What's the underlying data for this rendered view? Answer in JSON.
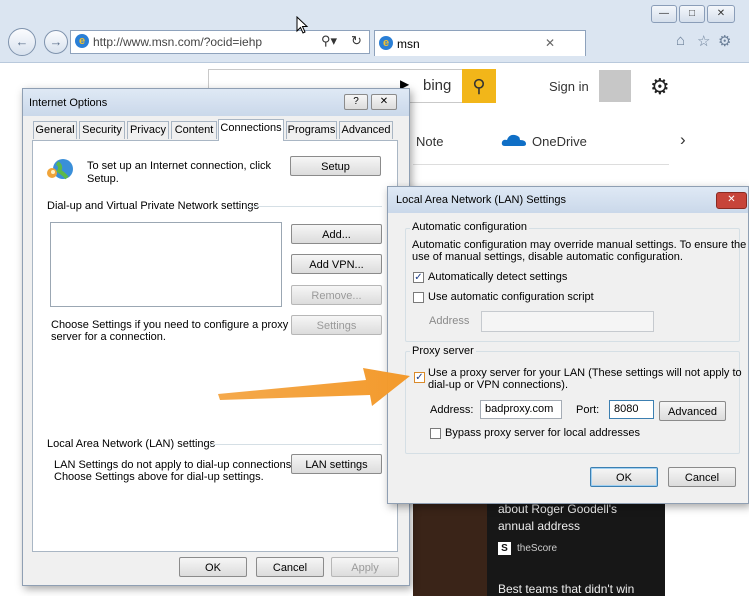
{
  "browser": {
    "url": "http://www.msn.com/?ocid=iehp",
    "url_host": "msn.com",
    "tab_label": "msn",
    "search_icon": "search-dropdown-icon",
    "refresh_icon": "refresh-icon"
  },
  "msn": {
    "bing_text": "bing",
    "signin": "Sign in",
    "nav_note": "Note",
    "nav_onedrive": "OneDrive",
    "news_line1": "about Roger Goodell's",
    "news_line2": "annual address",
    "news_source": "theScore",
    "news_next": "Best teams that didn't win"
  },
  "internet_options": {
    "title": "Internet Options",
    "tabs": [
      "General",
      "Security",
      "Privacy",
      "Content",
      "Connections",
      "Programs",
      "Advanced"
    ],
    "active_tab": "Connections",
    "setup_text_line1": "To set up an Internet connection, click",
    "setup_text_line2": "Setup.",
    "setup_button": "Setup",
    "dialup_section": "Dial-up and Virtual Private Network settings",
    "add_button": "Add...",
    "add_vpn_button": "Add VPN...",
    "remove_button": "Remove...",
    "settings_text_line1": "Choose Settings if you need to configure a proxy",
    "settings_text_line2": "server for a connection.",
    "settings_button": "Settings",
    "lan_section": "Local Area Network (LAN) settings",
    "lan_text_line1": "LAN Settings do not apply to dial-up connections.",
    "lan_text_line2": "Choose Settings above for dial-up settings.",
    "lan_button": "LAN settings",
    "ok": "OK",
    "cancel": "Cancel",
    "apply": "Apply",
    "help_glyph": "?",
    "close_glyph": "✕"
  },
  "lan_settings": {
    "title": "Local Area Network (LAN) Settings",
    "auto_group": "Automatic configuration",
    "auto_desc_line1": "Automatic configuration may override manual settings.  To ensure the",
    "auto_desc_line2": "use of manual settings, disable automatic configuration.",
    "auto_detect_label": "Automatically detect settings",
    "auto_detect_checked": true,
    "auto_script_label": "Use automatic configuration script",
    "auto_script_checked": false,
    "address_label": "Address",
    "address_value": "",
    "proxy_group": "Proxy server",
    "use_proxy_label_line1": "Use a proxy server for your LAN (These settings will not apply to",
    "use_proxy_label_line2": "dial-up or VPN connections).",
    "use_proxy_checked": true,
    "proxy_address_label": "Address:",
    "proxy_address_value": "badproxy.com",
    "port_label": "Port:",
    "port_value": "8080",
    "advanced_button": "Advanced",
    "bypass_label": "Bypass proxy server for local addresses",
    "bypass_checked": false,
    "ok": "OK",
    "cancel": "Cancel",
    "close_glyph": "✕"
  },
  "colors": {
    "accent_orange": "#f39a2c",
    "bing_yellow": "#f2b619",
    "close_red": "#c7443a",
    "chrome_blue": "#dbe5f1"
  }
}
